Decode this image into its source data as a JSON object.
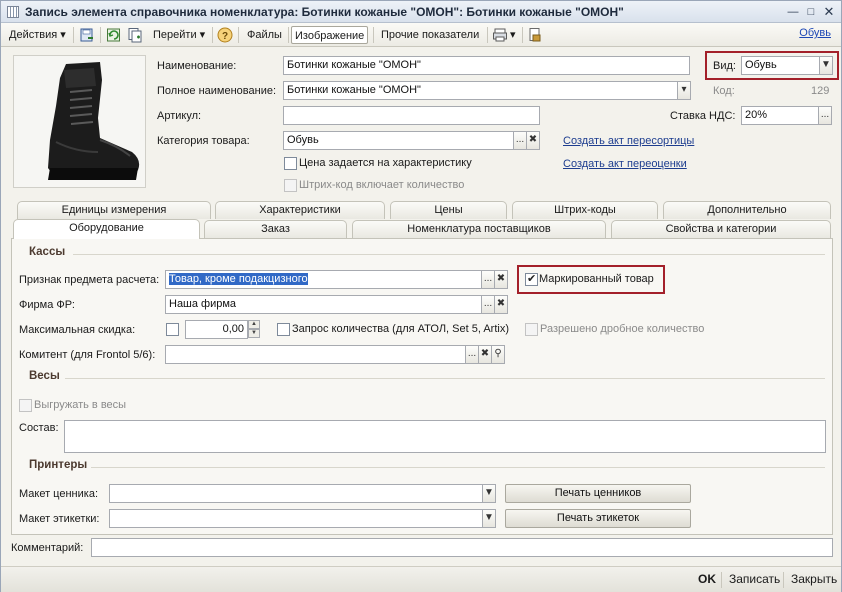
{
  "window": {
    "title": "Запись элемента справочника номенклатура: Ботинки кожаные \"ОМОН\": Ботинки кожаные \"ОМОН\""
  },
  "toolbar": {
    "actions": "Действия",
    "goto": "Перейти",
    "files": "Файлы",
    "image": "Изображение",
    "other_metrics": "Прочие показатели",
    "help": "Обувь"
  },
  "form": {
    "name_label": "Наименование:",
    "name_value": "Ботинки кожаные \"ОМОН\"",
    "full_name_label": "Полное наименование:",
    "full_name_value": "Ботинки кожаные \"ОМОН\"",
    "article_label": "Артикул:",
    "article_value": "",
    "category_label": "Категория товара:",
    "category_value": "Обувь",
    "price_by_characteristic": "Цена задается на характеристику",
    "barcode_includes_qty": "Штрих-код включает количество",
    "create_resort_act": "Создать акт пересортицы",
    "create_revaluation_act": "Создать акт переоценки",
    "kind_label": "Вид:",
    "kind_value": "Обувь",
    "code_label": "Код:",
    "code_value": "129",
    "vat_label": "Ставка НДС:",
    "vat_value": "20%"
  },
  "tabs_top": [
    "Единицы измерения",
    "Характеристики",
    "Цены",
    "Штрих-коды",
    "Дополнительно"
  ],
  "tabs_bottom": [
    "Оборудование",
    "Заказ",
    "Номенклатура поставщиков",
    "Свойства и категории"
  ],
  "equipment": {
    "kassy_title": "Кассы",
    "subject_label": "Признак предмета расчета:",
    "subject_value": "Товар, кроме подакцизного",
    "marked_goods": "Маркированный товар",
    "firm_label": "Фирма ФР:",
    "firm_value": "Наша фирма",
    "max_discount_label": "Максимальная скидка:",
    "max_discount_value": "0,00",
    "qty_request": "Запрос количества (для АТОЛ, Set 5, Artix)",
    "fractional_allowed": "Разрешено дробное количество",
    "komitent_label": "Комитент (для Frontol 5/6):",
    "komitent_value": "",
    "scales_title": "Весы",
    "unload_to_scales": "Выгружать в весы",
    "composition_label": "Состав:",
    "composition_value": "",
    "printers_title": "Принтеры",
    "price_tag_layout_label": "Макет ценника:",
    "price_tag_layout_value": "",
    "print_price_tags": "Печать ценников",
    "label_layout_label": "Макет этикетки:",
    "label_layout_value": "",
    "print_labels": "Печать этикеток"
  },
  "comment_label": "Комментарий:",
  "comment_value": "",
  "bottom": {
    "ok": "OK",
    "save": "Записать",
    "close": "Закрыть"
  },
  "colors": {
    "highlight_frame": "#a3202a",
    "selection": "#3169c6",
    "link": "#1d3d8f"
  }
}
